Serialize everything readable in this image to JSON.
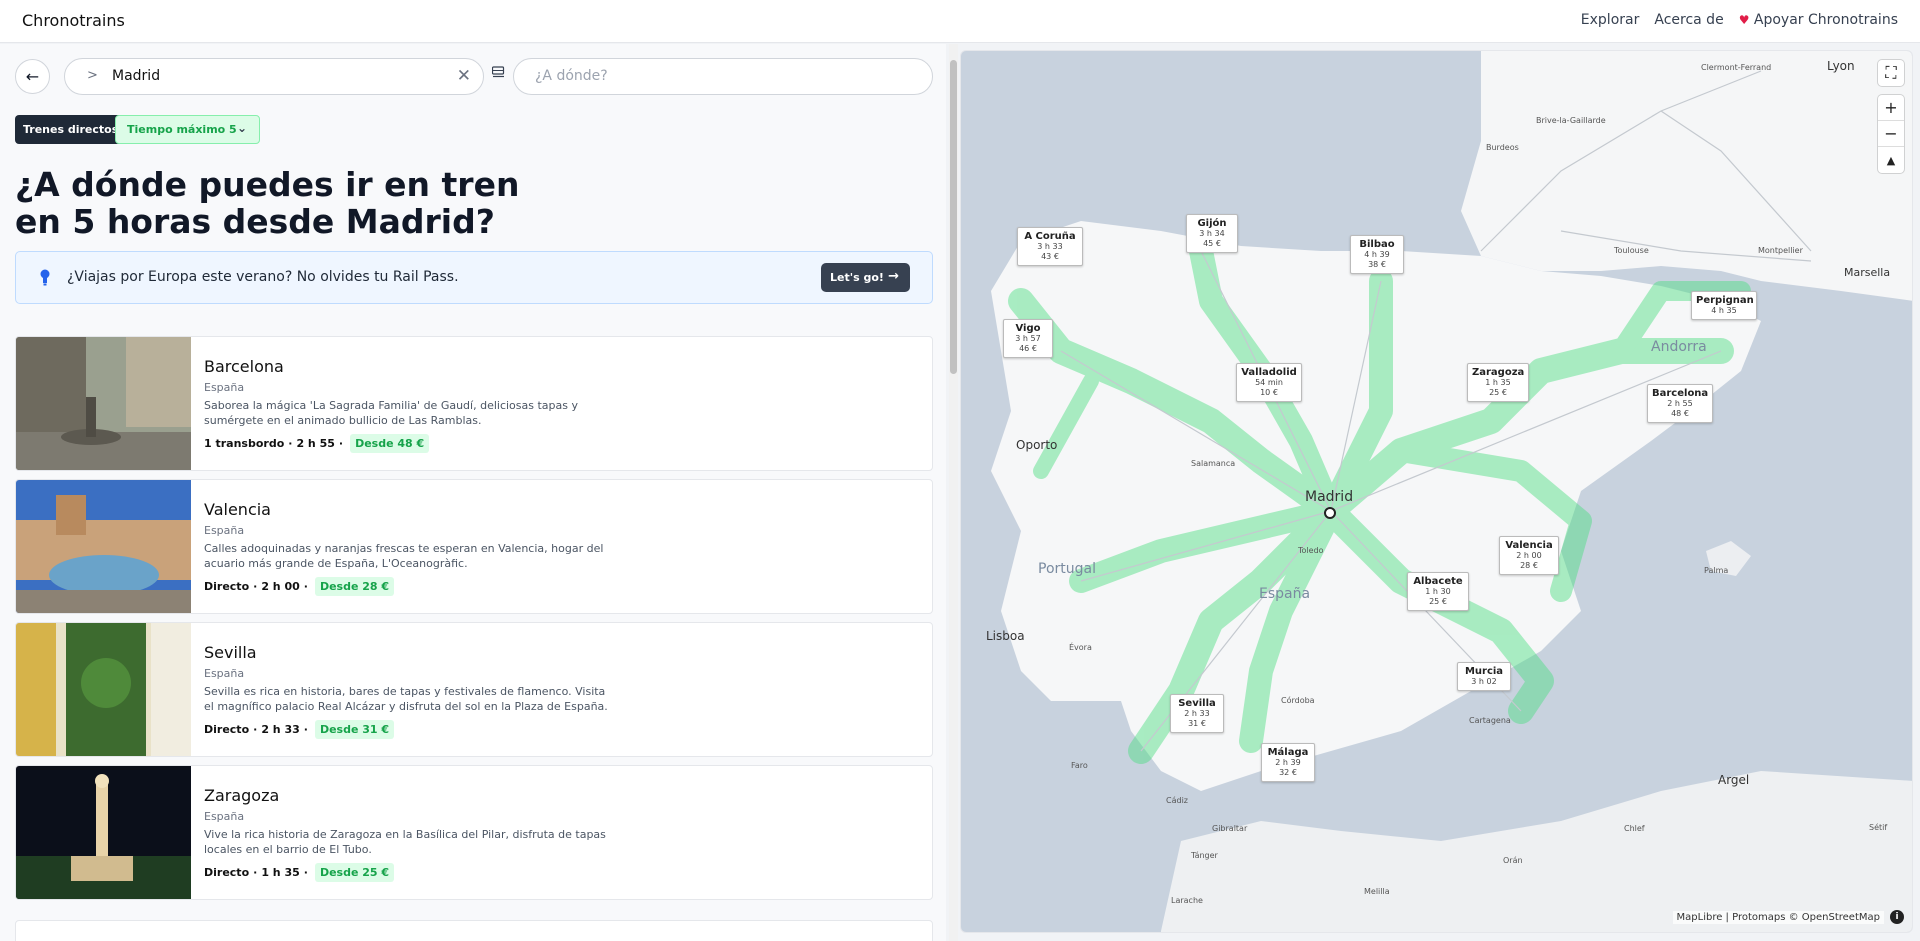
{
  "header": {
    "brand": "Chronotrains",
    "nav": [
      "Explorar",
      "Acerca de",
      "Apoyar Chronotrains"
    ]
  },
  "search": {
    "from_value": "Madrid",
    "to_placeholder": "¿A dónde?"
  },
  "filters": {
    "direct": "Trenes directos",
    "max_time": "Tiempo máximo 5"
  },
  "page_title": "¿A dónde puedes ir en tren en 5 horas desde Madrid?",
  "promo": {
    "text": "¿Viajas por Europa este verano? No olvides tu Rail Pass.",
    "button": "Let's go!"
  },
  "destinations": [
    {
      "name": "Barcelona",
      "country": "España",
      "description": "Saborea la mágica 'La Sagrada Familia' de Gaudí, deliciosas tapas y sumérgete en el animado bullicio de Las Ramblas.",
      "transfers": "1 transbordo",
      "duration": "2 h 55",
      "price": "Desde 48 €"
    },
    {
      "name": "Valencia",
      "country": "España",
      "description": "Calles adoquinadas y naranjas frescas te esperan en Valencia, hogar del acuario más grande de España, L'Oceanogràfic.",
      "transfers": "Directo",
      "duration": "2 h 00",
      "price": "Desde 28 €"
    },
    {
      "name": "Sevilla",
      "country": "España",
      "description": "Sevilla es rica en historia, bares de tapas y festivales de flamenco. Visita el magnífico palacio Real Alcázar y disfruta del sol en la Plaza de España.",
      "transfers": "Directo",
      "duration": "2 h 33",
      "price": "Desde 31 €"
    },
    {
      "name": "Zaragoza",
      "country": "España",
      "description": "Vive la rica historia de Zaragoza en la Basílica del Pilar, disfruta de tapas locales en el barrio de El Tubo.",
      "transfers": "Directo",
      "duration": "1 h 35",
      "price": "Desde 25 €"
    }
  ],
  "map": {
    "origin": "Madrid",
    "attribution": "MapLibre | Protomaps © OpenStreetMap",
    "region_labels": [
      "España",
      "Portugal",
      "Andorra"
    ],
    "place_labels": [
      "Oporto",
      "Lisboa",
      "Salamanca",
      "Toledo",
      "Córdoba",
      "Évora",
      "Faro",
      "Cádiz",
      "Gibraltar",
      "Cartagena",
      "Burdeos",
      "Toulouse",
      "Montpellier",
      "Marsella",
      "Lyon",
      "Clermont-Ferrand",
      "Brive-la-Gaillarde",
      "Palma",
      "Argel",
      "Orán",
      "Tánger",
      "Melilla",
      "Larache",
      "Chlef",
      "Sétif"
    ],
    "cities": [
      {
        "name": "A Coruña",
        "duration": "3 h 33",
        "price": "43 €"
      },
      {
        "name": "Gijón",
        "duration": "3 h 34",
        "price": "45 €"
      },
      {
        "name": "Bilbao",
        "duration": "4 h 39",
        "price": "38 €"
      },
      {
        "name": "Vigo",
        "duration": "3 h 57",
        "price": "46 €"
      },
      {
        "name": "Valladolid",
        "duration": "54 min",
        "price": "10 €"
      },
      {
        "name": "Zaragoza",
        "duration": "1 h 35",
        "price": "25 €"
      },
      {
        "name": "Perpignan",
        "duration": "4 h 35",
        "price": ""
      },
      {
        "name": "Barcelona",
        "duration": "2 h 55",
        "price": "48 €"
      },
      {
        "name": "Valencia",
        "duration": "2 h 00",
        "price": "28 €"
      },
      {
        "name": "Albacete",
        "duration": "1 h 30",
        "price": "25 €"
      },
      {
        "name": "Murcia",
        "duration": "3 h 02",
        "price": ""
      },
      {
        "name": "Sevilla",
        "duration": "2 h 33",
        "price": "31 €"
      },
      {
        "name": "Málaga",
        "duration": "2 h 39",
        "price": "32 €"
      }
    ]
  },
  "colors": {
    "accent_green": "#22c55e",
    "dark": "#1f2937",
    "sea": "#c8d2de"
  }
}
